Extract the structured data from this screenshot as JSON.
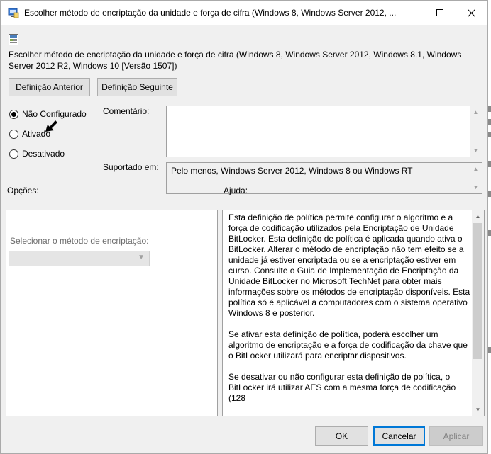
{
  "window": {
    "title": "Escolher método de encriptação da unidade e força de cifra (Windows 8, Windows Server 2012, ...",
    "policy_title": "Escolher método de encriptação da unidade e força de cifra (Windows 8, Windows Server 2012, Windows 8.1, Windows Server 2012 R2, Windows 10 [Versão 1507])"
  },
  "nav": {
    "prev_label": "Definição Anterior",
    "next_label": "Definição Seguinte"
  },
  "state": {
    "options": [
      "Não Configurado",
      "Ativado",
      "Desativado"
    ],
    "selected": "Não Configurado"
  },
  "comment": {
    "label": "Comentário:",
    "value": ""
  },
  "supported": {
    "label": "Suportado em:",
    "value": "Pelo menos, Windows Server 2012, Windows 8 ou Windows RT"
  },
  "options_section": {
    "label": "Opções:",
    "method_label": "Selecionar o método de encriptação:",
    "method_value": ""
  },
  "help": {
    "label": "Ajuda:",
    "paragraphs": [
      "Esta definição de política permite configurar o algoritmo e a força de codificação utilizados pela Encriptação de Unidade BitLocker. Esta definição de política é aplicada quando ativa o BitLocker. Alterar o método de encriptação não tem efeito se a unidade já estiver encriptada ou se a encriptação estiver em curso. Consulte o Guia de Implementação de Encriptação da Unidade BitLocker no Microsoft TechNet para obter mais informações sobre os métodos de encriptação disponíveis. Esta política só é aplicável a computadores com o sistema operativo Windows 8 e posterior.",
      "Se ativar esta definição de política, poderá escolher um algoritmo de encriptação e a força de codificação da chave que o BitLocker utilizará para encriptar dispositivos.",
      "Se desativar ou não configurar esta definição de política, o BitLocker irá utilizar AES com a mesma força de codificação (128"
    ]
  },
  "footer": {
    "ok_label": "OK",
    "cancel_label": "Cancelar",
    "apply_label": "Aplicar"
  },
  "colors": {
    "accent": "#0078d7",
    "window_bg": "#f0f0f0"
  }
}
